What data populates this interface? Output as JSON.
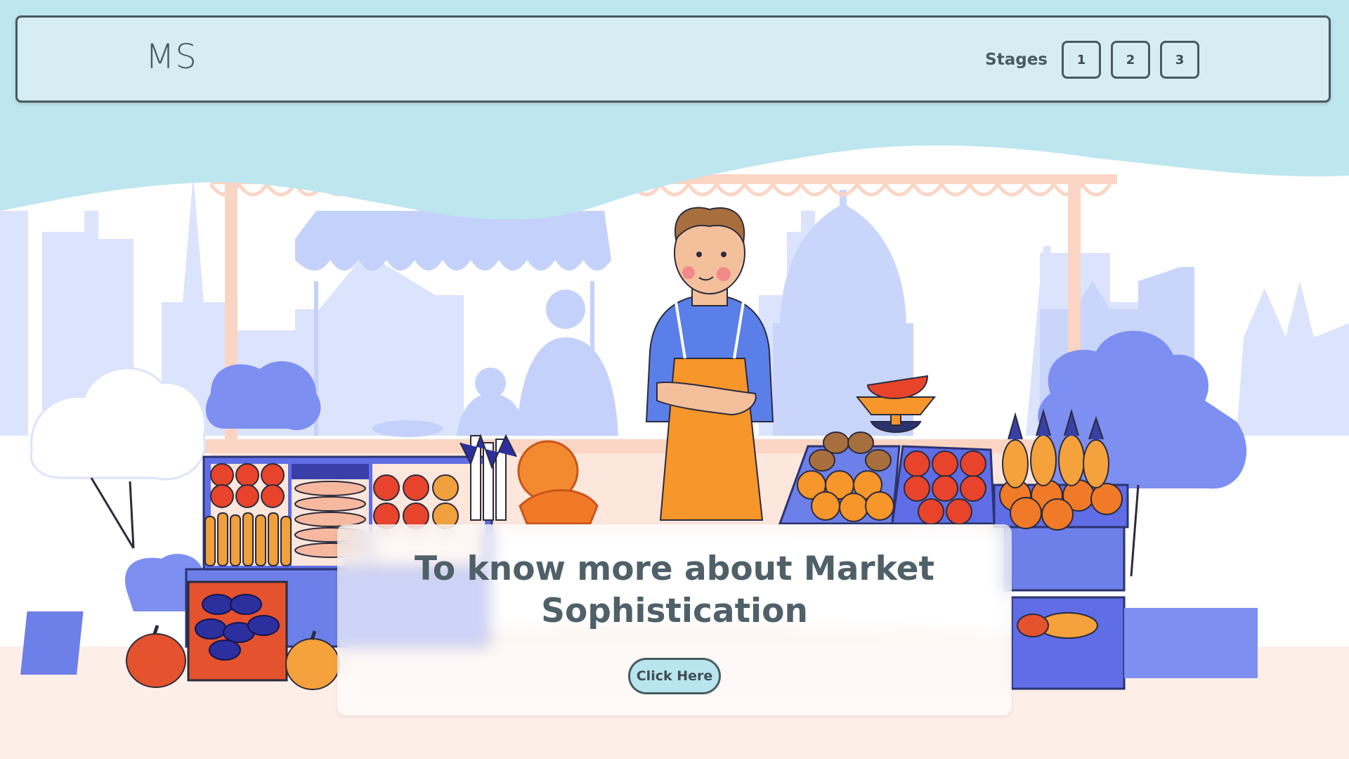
{
  "brand": {
    "logo_text": "MS"
  },
  "stages": {
    "label": "Stages",
    "buttons": [
      "1",
      "2",
      "3"
    ]
  },
  "hero": {
    "title": "To know more about Market Sophistication",
    "button_label": "Click Here"
  },
  "illustration": {
    "subject": "vendor-at-market-stall",
    "icons": [
      "city-skyline",
      "market-awning",
      "vendor",
      "tomatoes",
      "carrots",
      "eggplants",
      "pumpkins",
      "oranges",
      "apples",
      "pineapples",
      "watermelon",
      "scale",
      "tree",
      "crate"
    ]
  },
  "colors": {
    "top_wave": "#bde6ef",
    "navbar_bg": "#d6eef3",
    "border": "#4a5a60",
    "text": "#4f6068",
    "button_bg": "#b9e5ee",
    "skyline": "#c9d5fb",
    "crate_blue": "#5f6ee6",
    "apron_orange": "#f7962a",
    "ground": "#fde1d6"
  }
}
